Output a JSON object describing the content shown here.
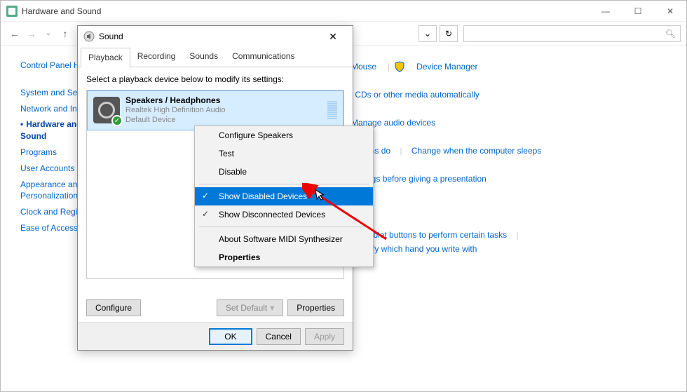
{
  "window": {
    "title": "Hardware and Sound"
  },
  "toolbar": {
    "search_placeholder": "",
    "dropdown_symbol": "⌄",
    "refresh_symbol": "↻"
  },
  "sidebar": {
    "home": "Control Panel Home",
    "items": [
      {
        "label": "System and Security",
        "current": false
      },
      {
        "label": "Network and Internet",
        "current": false
      },
      {
        "label": "Hardware and Sound",
        "current": true
      },
      {
        "label": "Programs",
        "current": false
      },
      {
        "label": "User Accounts",
        "current": false
      },
      {
        "label": "Appearance and Personalization",
        "current": false
      },
      {
        "label": "Clock and Region",
        "current": false
      },
      {
        "label": "Ease of Access",
        "current": false
      }
    ]
  },
  "main": {
    "row1": {
      "mouse": "Mouse",
      "dm": "Device Manager"
    },
    "row2": {
      "a": "CDs or other media automatically"
    },
    "row3": {
      "a": "Manage audio devices"
    },
    "row4": {
      "a": "buttons do",
      "b": "Change when the computer sleeps"
    },
    "row5": {
      "a": "settings before giving a presentation"
    },
    "row6": {
      "a": "Set tablet buttons to perform certain tasks",
      "b": "Specify which hand you write with"
    }
  },
  "dialog": {
    "title": "Sound",
    "tabs": [
      "Playback",
      "Recording",
      "Sounds",
      "Communications"
    ],
    "instruction": "Select a playback device below to modify its settings:",
    "device": {
      "name": "Speakers / Headphones",
      "driver": "Realtek High Definition Audio",
      "status": "Default Device"
    },
    "buttons": {
      "configure": "Configure",
      "setdefault": "Set Default",
      "properties": "Properties",
      "ok": "OK",
      "cancel": "Cancel",
      "apply": "Apply"
    }
  },
  "context_menu": {
    "items": [
      {
        "label": "Configure Speakers"
      },
      {
        "label": "Test"
      },
      {
        "label": "Disable"
      },
      {
        "sep": true
      },
      {
        "label": "Show Disabled Devices",
        "checked": true,
        "selected": true
      },
      {
        "label": "Show Disconnected Devices",
        "checked": true
      },
      {
        "sep": true
      },
      {
        "label": "About Software MIDI Synthesizer"
      },
      {
        "label": "Properties",
        "bold": true
      }
    ]
  },
  "chart_data": null
}
